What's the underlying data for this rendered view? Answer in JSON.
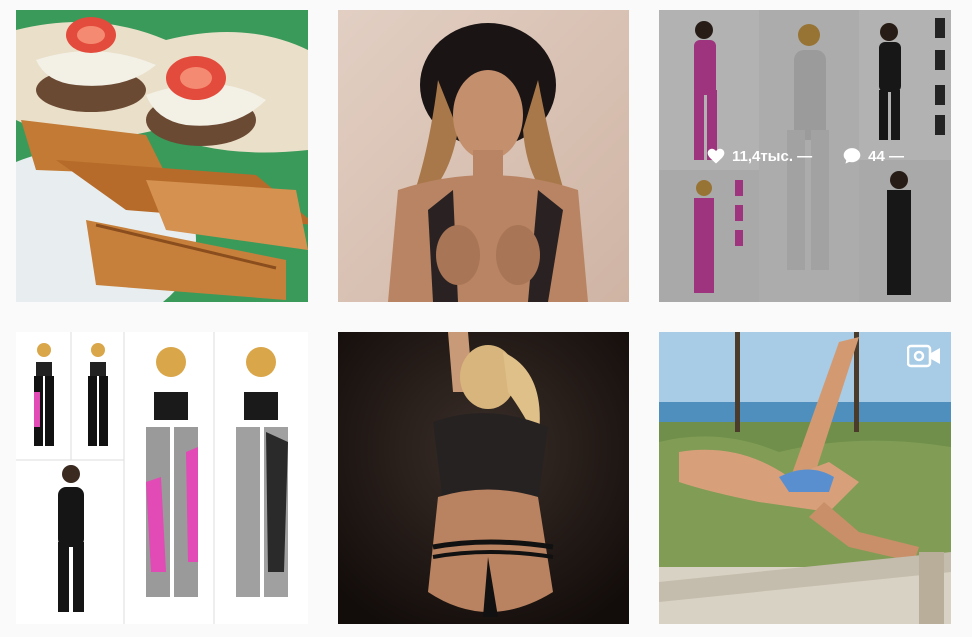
{
  "posts": [
    {
      "id": "post-food",
      "type": "image"
    },
    {
      "id": "post-portrait",
      "type": "image"
    },
    {
      "id": "post-catalog-pink",
      "type": "image",
      "hovered": true,
      "likes": "11,4тыс. —",
      "comments": "44 —"
    },
    {
      "id": "post-catalog-leggings",
      "type": "image"
    },
    {
      "id": "post-dark-studio",
      "type": "image"
    },
    {
      "id": "post-beach",
      "type": "video"
    }
  ],
  "icons": {
    "like": "heart-icon",
    "comment": "comment-bubble-icon",
    "video": "video-camera-icon"
  },
  "colors": {
    "background": "#fafafa",
    "overlay": "rgba(0,0,0,0.30)",
    "overlay_text": "#ffffff"
  }
}
